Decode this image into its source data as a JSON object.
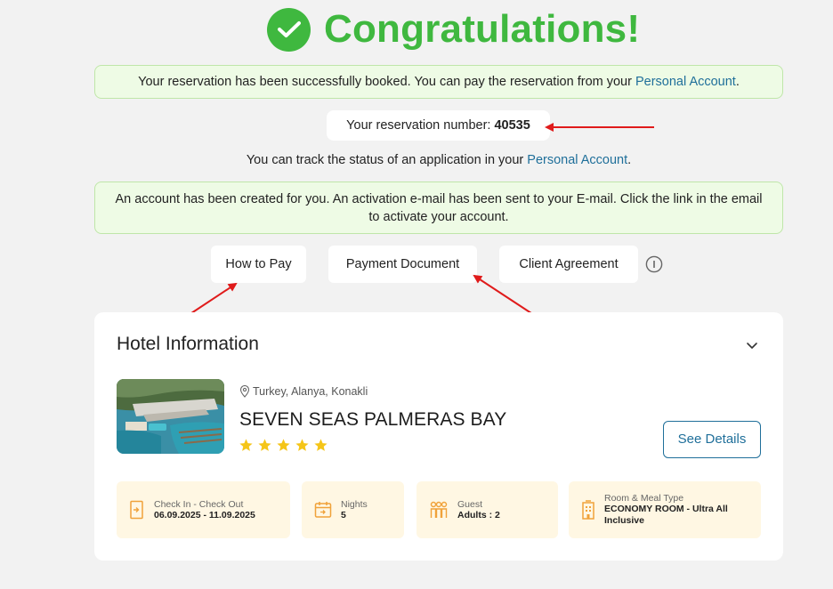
{
  "header": {
    "title": "Congratulations!"
  },
  "notice_booked": {
    "text": "Your reservation has been successfully booked. You can pay the reservation from your ",
    "link": "Personal Account",
    "suffix": "."
  },
  "reservation": {
    "label": "Your reservation number: ",
    "number": "40535"
  },
  "track": {
    "text": "You can track the status of an application in your ",
    "link": "Personal Account",
    "suffix": "."
  },
  "notice_account": {
    "text": "An account has been created for you. An activation e-mail has been sent to your E-mail. Click the link in the email to activate your account."
  },
  "buttons": {
    "how_to_pay": "How to Pay",
    "payment_document": "Payment Document",
    "client_agreement": "Client Agreement"
  },
  "hotel": {
    "section_title": "Hotel Information",
    "location": "Turkey, Alanya, Konakli",
    "name": "SEVEN SEAS PALMERAS BAY",
    "stars": 5,
    "see_details": "See Details",
    "tiles": {
      "checkin": {
        "label": "Check In - Check Out",
        "value": "06.09.2025 - 11.09.2025"
      },
      "nights": {
        "label": "Nights",
        "value": "5"
      },
      "guest": {
        "label": "Guest",
        "value": "Adults : 2"
      },
      "room": {
        "label": "Room & Meal Type",
        "value": "ECONOMY ROOM - Ultra All Inclusive"
      }
    }
  },
  "colors": {
    "success": "#3fb83f",
    "link": "#1f6f9a",
    "star": "#f5c518",
    "tile_bg": "#fff7e3",
    "tile_icon": "#f0a23a",
    "arrow": "#e01b1b"
  },
  "icons": [
    "check-icon",
    "info-icon",
    "chevron-down-icon",
    "location-pin-icon",
    "star-icon",
    "door-icon",
    "calendar-icon",
    "guests-icon",
    "hotel-building-icon"
  ]
}
